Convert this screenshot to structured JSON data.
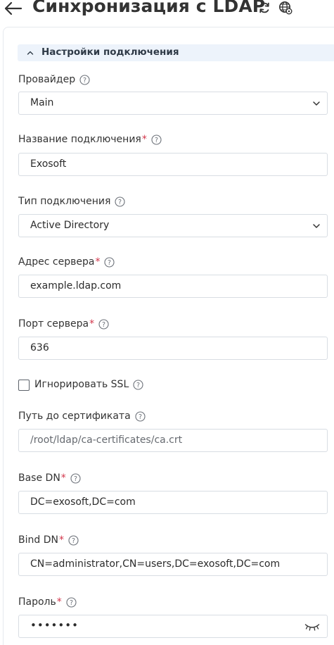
{
  "header": {
    "title": "Синхронизация с LDAP",
    "icons": [
      "arrow-left-icon",
      "refresh-icon",
      "globe-settings-icon"
    ]
  },
  "section": {
    "title": "Настройки подключения",
    "expanded": true
  },
  "fields": {
    "provider": {
      "label": "Провайдер",
      "required": false,
      "value": "Main"
    },
    "connection_name": {
      "label": "Название подключения",
      "required": true,
      "value": "Exosoft"
    },
    "connection_type": {
      "label": "Тип подключения",
      "required": false,
      "value": "Active Directory"
    },
    "server_address": {
      "label": "Адрес сервера",
      "required": true,
      "value": "example.ldap.com"
    },
    "server_port": {
      "label": "Порт сервера",
      "required": true,
      "value": "636"
    },
    "ignore_ssl": {
      "label": "Игнорировать SSL",
      "checked": false
    },
    "cert_path": {
      "label": "Путь до сертификата",
      "required": false,
      "value": "/root/ldap/ca-certificates/ca.crt"
    },
    "base_dn": {
      "label": "Base DN",
      "required": true,
      "value": "DC=exosoft,DC=com"
    },
    "bind_dn": {
      "label": "Bind DN",
      "required": true,
      "value": "CN=administrator,CN=users,DC=exosoft,DC=com"
    },
    "password": {
      "label": "Пароль",
      "required": true,
      "value": "•••••••"
    }
  },
  "required_mark": "*",
  "colors": {
    "required": "#d2354a",
    "section_bg": "#edf3fb",
    "border": "#d8dde3"
  }
}
